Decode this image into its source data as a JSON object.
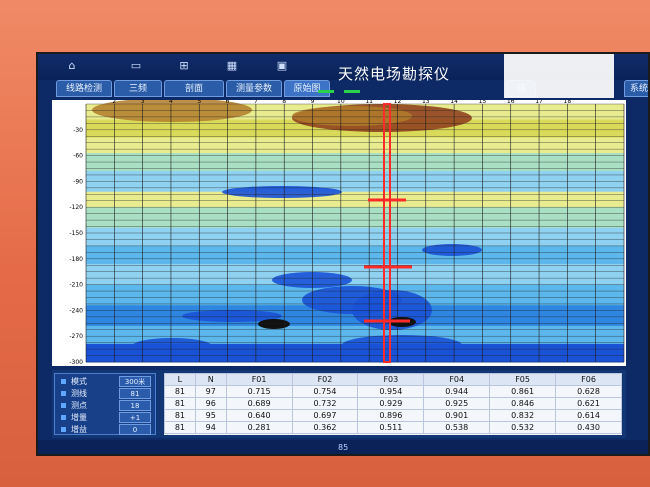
{
  "toolbar": {
    "icons": [
      "home-icon",
      "file-icon",
      "file-plus-icon",
      "grid-icon",
      "image-icon"
    ],
    "title": "天然电场勘探仪"
  },
  "tabs": [
    {
      "label": "线路检测",
      "active": false
    },
    {
      "label": "三频",
      "active": false
    },
    {
      "label": "剖面",
      "active": false
    },
    {
      "label": "测量参数",
      "active": false
    },
    {
      "label": "原始图",
      "active": true
    }
  ],
  "right_tabs": [
    "辅",
    "系统"
  ],
  "chart_data": {
    "type": "heatmap",
    "x_ticks": [
      "2",
      "3",
      "4",
      "5",
      "6",
      "7",
      "8",
      "9",
      "10",
      "11",
      "12",
      "13",
      "14",
      "15",
      "16",
      "17",
      "18"
    ],
    "y_ticks": [
      "-30",
      "-60",
      "-90",
      "-120",
      "-150",
      "-180",
      "-210",
      "-240",
      "-270",
      "-300"
    ],
    "ylim": [
      -300,
      0
    ],
    "palette": [
      "#8c3a1a",
      "#b07d2b",
      "#d9d95a",
      "#e8ec8f",
      "#a9e0c3",
      "#8fd1f0",
      "#5cb7ec",
      "#2f86e0",
      "#1a52d6",
      "#111111"
    ]
  },
  "panel": {
    "rows": [
      {
        "label": "模式",
        "value": "300米"
      },
      {
        "label": "测线",
        "value": "81"
      },
      {
        "label": "测点",
        "value": "18"
      },
      {
        "label": "增量",
        "value": "+1"
      },
      {
        "label": "增益",
        "value": "0"
      }
    ]
  },
  "table": {
    "headers": [
      "L",
      "N",
      "F01",
      "F02",
      "F03",
      "F04",
      "F05",
      "F06"
    ],
    "rows": [
      [
        "81",
        "97",
        "0.715",
        "0.754",
        "0.954",
        "0.944",
        "0.861",
        "0.628"
      ],
      [
        "81",
        "96",
        "0.689",
        "0.732",
        "0.929",
        "0.925",
        "0.846",
        "0.621"
      ],
      [
        "81",
        "95",
        "0.640",
        "0.697",
        "0.896",
        "0.901",
        "0.832",
        "0.614"
      ],
      [
        "81",
        "94",
        "0.281",
        "0.362",
        "0.511",
        "0.538",
        "0.532",
        "0.430"
      ]
    ]
  },
  "status_text": "85"
}
